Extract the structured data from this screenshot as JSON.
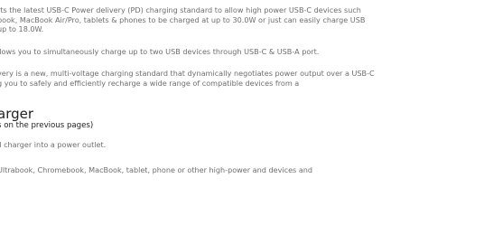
{
  "intro": {
    "line1": "rts the latest USB-C Power delivery (PD) charging standard to allow high power USB-C devices such",
    "line2": "book, MacBook Air/Pro, tablets & phones to be charged at up to 30.0W or just can easily charge USB",
    "line3": "up to 18.0W."
  },
  "dual": {
    "line1": "llows you to simultaneously charge up to two USB devices through USB-C & USB-A port."
  },
  "pd_info": {
    "line1": "very is a new, multi-voltage charging standard that dynamically negotiates power output over a USB-C",
    "line2": "g you to safely and efficiently recharge a wide range of compatible devices from a"
  },
  "section": {
    "title": "arger",
    "subtitle": "s on the previous pages)"
  },
  "steps": {
    "step1": "ll charger into a power outlet.",
    "step2": "Ultrabook, Chromebook, MacBook, tablet, phone or other high-power and devices and"
  }
}
